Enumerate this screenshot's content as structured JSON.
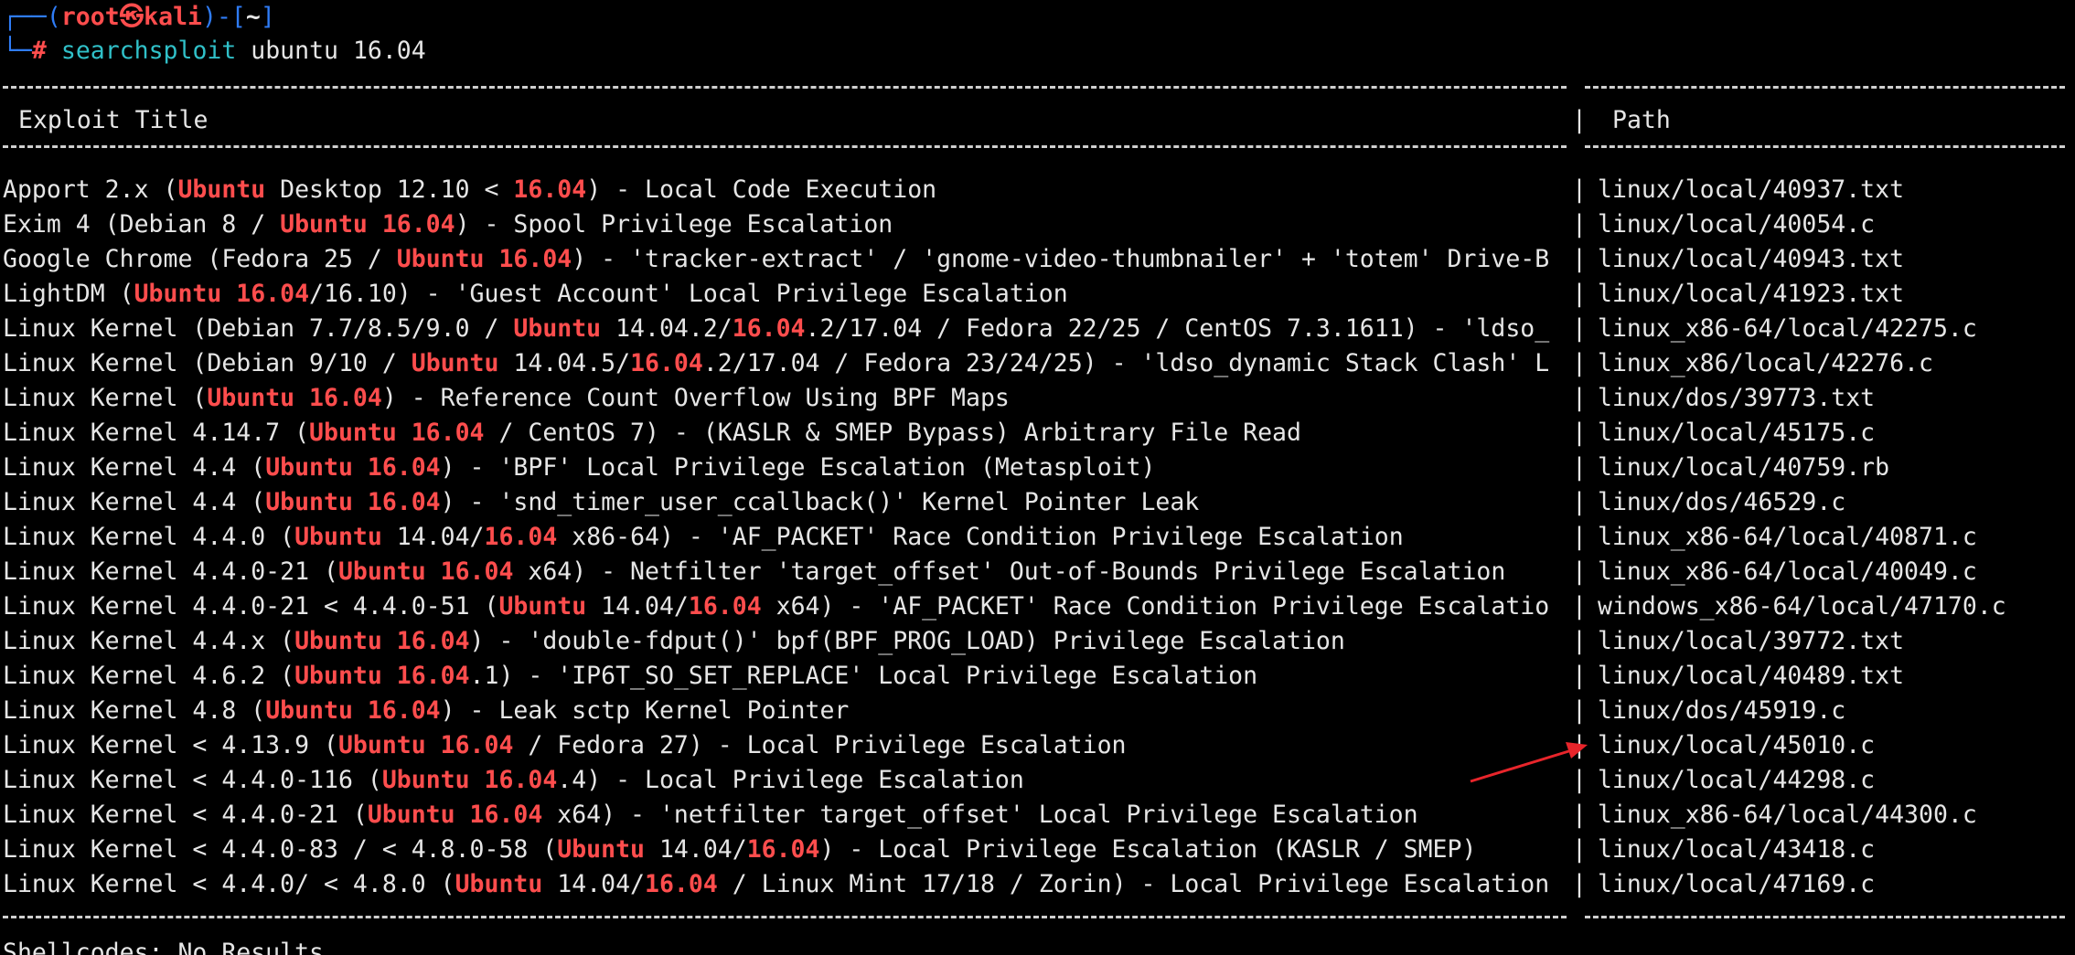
{
  "prompt": {
    "corner_top": "┌──",
    "open_paren": "(",
    "user": "root",
    "at_symbol": "㉿",
    "host": "kali",
    "close_paren": ")-[",
    "cwd": "~",
    "close_bracket": "]",
    "corner_bot": "└─",
    "hash": "#",
    "command": "searchsploit",
    "args": " ubuntu 16.04"
  },
  "header": {
    "title": "Exploit Title",
    "separator": "|",
    "path": "Path"
  },
  "rows": [
    {
      "title": [
        {
          "t": "Apport 2.x ("
        },
        {
          "t": "Ubuntu",
          "h": 1
        },
        {
          "t": " Desktop 12.10 < "
        },
        {
          "t": "16.04",
          "h": 1
        },
        {
          "t": ") - Local Code Execution"
        }
      ],
      "path": "linux/local/40937.txt"
    },
    {
      "title": [
        {
          "t": "Exim 4 (Debian 8 / "
        },
        {
          "t": "Ubuntu 16.04",
          "h": 1
        },
        {
          "t": ") - Spool Privilege Escalation"
        }
      ],
      "path": "linux/local/40054.c"
    },
    {
      "title": [
        {
          "t": "Google Chrome (Fedora 25 / "
        },
        {
          "t": "Ubuntu 16.04",
          "h": 1
        },
        {
          "t": ") - 'tracker-extract' / 'gnome-video-thumbnailer' + 'totem' Drive-B"
        }
      ],
      "path": "linux/local/40943.txt"
    },
    {
      "title": [
        {
          "t": "LightDM ("
        },
        {
          "t": "Ubuntu 16.04",
          "h": 1
        },
        {
          "t": "/16.10) - 'Guest Account' Local Privilege Escalation"
        }
      ],
      "path": "linux/local/41923.txt"
    },
    {
      "title": [
        {
          "t": "Linux Kernel (Debian 7.7/8.5/9.0 / "
        },
        {
          "t": "Ubuntu",
          "h": 1
        },
        {
          "t": " 14.04.2/"
        },
        {
          "t": "16.04",
          "h": 1
        },
        {
          "t": ".2/17.04 / Fedora 22/25 / CentOS 7.3.1611) - 'ldso_"
        }
      ],
      "path": "linux_x86-64/local/42275.c"
    },
    {
      "title": [
        {
          "t": "Linux Kernel (Debian 9/10 / "
        },
        {
          "t": "Ubuntu",
          "h": 1
        },
        {
          "t": " 14.04.5/"
        },
        {
          "t": "16.04",
          "h": 1
        },
        {
          "t": ".2/17.04 / Fedora 23/24/25) - 'ldso_dynamic Stack Clash' L"
        }
      ],
      "path": "linux_x86/local/42276.c"
    },
    {
      "title": [
        {
          "t": "Linux Kernel ("
        },
        {
          "t": "Ubuntu 16.04",
          "h": 1
        },
        {
          "t": ") - Reference Count Overflow Using BPF Maps"
        }
      ],
      "path": "linux/dos/39773.txt"
    },
    {
      "title": [
        {
          "t": "Linux Kernel 4.14.7 ("
        },
        {
          "t": "Ubuntu 16.04",
          "h": 1
        },
        {
          "t": " / CentOS 7) - (KASLR & SMEP Bypass) Arbitrary File Read"
        }
      ],
      "path": "linux/local/45175.c"
    },
    {
      "title": [
        {
          "t": "Linux Kernel 4.4 ("
        },
        {
          "t": "Ubuntu 16.04",
          "h": 1
        },
        {
          "t": ") - 'BPF' Local Privilege Escalation (Metasploit)"
        }
      ],
      "path": "linux/local/40759.rb"
    },
    {
      "title": [
        {
          "t": "Linux Kernel 4.4 ("
        },
        {
          "t": "Ubuntu 16.04",
          "h": 1
        },
        {
          "t": ") - 'snd_timer_user_ccallback()' Kernel Pointer Leak"
        }
      ],
      "path": "linux/dos/46529.c"
    },
    {
      "title": [
        {
          "t": "Linux Kernel 4.4.0 ("
        },
        {
          "t": "Ubuntu",
          "h": 1
        },
        {
          "t": " 14.04/"
        },
        {
          "t": "16.04",
          "h": 1
        },
        {
          "t": " x86-64) - 'AF_PACKET' Race Condition Privilege Escalation"
        }
      ],
      "path": "linux_x86-64/local/40871.c"
    },
    {
      "title": [
        {
          "t": "Linux Kernel 4.4.0-21 ("
        },
        {
          "t": "Ubuntu 16.04",
          "h": 1
        },
        {
          "t": " x64) - Netfilter 'target_offset' Out-of-Bounds Privilege Escalation"
        }
      ],
      "path": "linux_x86-64/local/40049.c"
    },
    {
      "title": [
        {
          "t": "Linux Kernel 4.4.0-21 < 4.4.0-51 ("
        },
        {
          "t": "Ubuntu",
          "h": 1
        },
        {
          "t": " 14.04/"
        },
        {
          "t": "16.04",
          "h": 1
        },
        {
          "t": " x64) - 'AF_PACKET' Race Condition Privilege Escalatio"
        }
      ],
      "path": "windows_x86-64/local/47170.c"
    },
    {
      "title": [
        {
          "t": "Linux Kernel 4.4.x ("
        },
        {
          "t": "Ubuntu 16.04",
          "h": 1
        },
        {
          "t": ") - 'double-fdput()' bpf(BPF_PROG_LOAD) Privilege Escalation"
        }
      ],
      "path": "linux/local/39772.txt"
    },
    {
      "title": [
        {
          "t": "Linux Kernel 4.6.2 ("
        },
        {
          "t": "Ubuntu 16.04",
          "h": 1
        },
        {
          "t": ".1) - 'IP6T_SO_SET_REPLACE' Local Privilege Escalation"
        }
      ],
      "path": "linux/local/40489.txt"
    },
    {
      "title": [
        {
          "t": "Linux Kernel 4.8 ("
        },
        {
          "t": "Ubuntu 16.04",
          "h": 1
        },
        {
          "t": ") - Leak sctp Kernel Pointer"
        }
      ],
      "path": "linux/dos/45919.c"
    },
    {
      "title": [
        {
          "t": "Linux Kernel < 4.13.9 ("
        },
        {
          "t": "Ubuntu 16.04",
          "h": 1
        },
        {
          "t": " / Fedora 27) - Local Privilege Escalation"
        }
      ],
      "path": "linux/local/45010.c"
    },
    {
      "title": [
        {
          "t": "Linux Kernel < 4.4.0-116 ("
        },
        {
          "t": "Ubuntu 16.04",
          "h": 1
        },
        {
          "t": ".4) - Local Privilege Escalation"
        }
      ],
      "path": "linux/local/44298.c"
    },
    {
      "title": [
        {
          "t": "Linux Kernel < 4.4.0-21 ("
        },
        {
          "t": "Ubuntu 16.04",
          "h": 1
        },
        {
          "t": " x64) - 'netfilter target_offset' Local Privilege Escalation"
        }
      ],
      "path": "linux_x86-64/local/44300.c"
    },
    {
      "title": [
        {
          "t": "Linux Kernel < 4.4.0-83 / < 4.8.0-58 ("
        },
        {
          "t": "Ubuntu",
          "h": 1
        },
        {
          "t": " 14.04/"
        },
        {
          "t": "16.04",
          "h": 1
        },
        {
          "t": ") - Local Privilege Escalation (KASLR / SMEP)"
        }
      ],
      "path": "linux/local/43418.c"
    },
    {
      "title": [
        {
          "t": "Linux Kernel < 4.4.0/ < 4.8.0 ("
        },
        {
          "t": "Ubuntu",
          "h": 1
        },
        {
          "t": " 14.04/"
        },
        {
          "t": "16.04",
          "h": 1
        },
        {
          "t": " / Linux Mint 17/18 / Zorin) - Local Privilege Escalation"
        }
      ],
      "path": "linux/local/47169.c"
    }
  ],
  "row_separator": "|",
  "footer": "Shellcodes: No Results",
  "colors": {
    "background": "#000000",
    "text": "#e6e6e6",
    "prompt_blue": "#2f7cf6",
    "prompt_red": "#ff4d4d",
    "command_cyan": "#30c0c8",
    "highlight": "#ff4d4d",
    "annotation_arrow": "#e8252b"
  }
}
